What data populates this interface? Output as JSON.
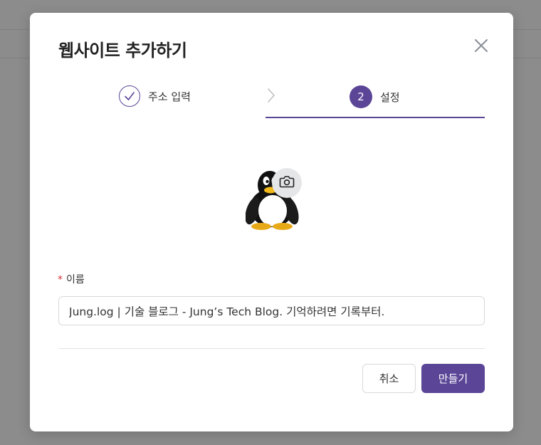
{
  "modal": {
    "title": "웹사이트 추가하기"
  },
  "steps": [
    {
      "label": "주소 입력",
      "status": "completed"
    },
    {
      "number": "2",
      "label": "설정",
      "status": "active"
    }
  ],
  "avatar": {
    "icon": "penguin-icon",
    "edit_icon": "camera-icon"
  },
  "form": {
    "name_required_mark": "*",
    "name_label": "이름",
    "name_value": "Jung.log | 기술 블로그 - Jung’s Tech Blog. 기억하려면 기록부터."
  },
  "buttons": {
    "cancel": "취소",
    "create": "만들기"
  },
  "colors": {
    "accent": "#5b4597",
    "required": "#d9363e",
    "overlay": "#8c8c8c"
  }
}
